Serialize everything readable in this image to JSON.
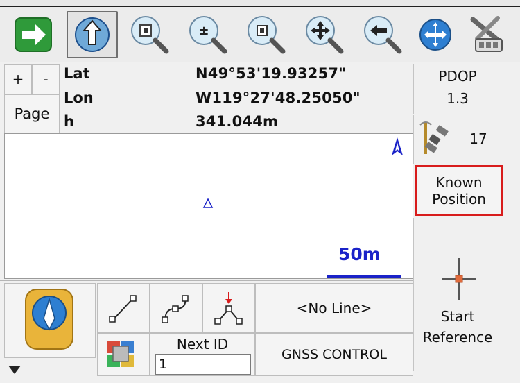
{
  "toolbar": {
    "buttons": [
      {
        "name": "next-arrow-icon"
      },
      {
        "name": "pan-cursor-icon"
      },
      {
        "name": "zoom-extents-icon"
      },
      {
        "name": "zoom-in-out-icon"
      },
      {
        "name": "zoom-window-icon"
      },
      {
        "name": "zoom-pan-icon"
      },
      {
        "name": "zoom-previous-icon"
      },
      {
        "name": "globe-icon"
      },
      {
        "name": "settings-tools-icon"
      }
    ]
  },
  "position": {
    "zoom_plus": "+",
    "zoom_minus": "-",
    "page_label": "Page",
    "lat_label": "Lat",
    "lat_value": "N49°53'19.93257\"",
    "lon_label": "Lon",
    "lon_value": "W119°27'48.25050\"",
    "h_label": "h",
    "h_value": "341.044m"
  },
  "status": {
    "pdop_label": "PDOP",
    "pdop_value": "1.3",
    "satellite_count": "17"
  },
  "map": {
    "scale_label": "50m",
    "accent": "#1a22c8"
  },
  "sidepanel": {
    "known_position_line1": "Known",
    "known_position_line2": "Position",
    "start_reference_line1": "Start",
    "start_reference_line2": "Reference"
  },
  "bottom": {
    "line_select": "<No Line>",
    "next_id_label": "Next ID",
    "next_id_value": "1",
    "gnss_control": "GNSS CONTROL"
  },
  "colors": {
    "highlight_border": "#d81c1c",
    "arrow_green": "#2f9a3a",
    "accent_blue": "#1a22c8"
  }
}
